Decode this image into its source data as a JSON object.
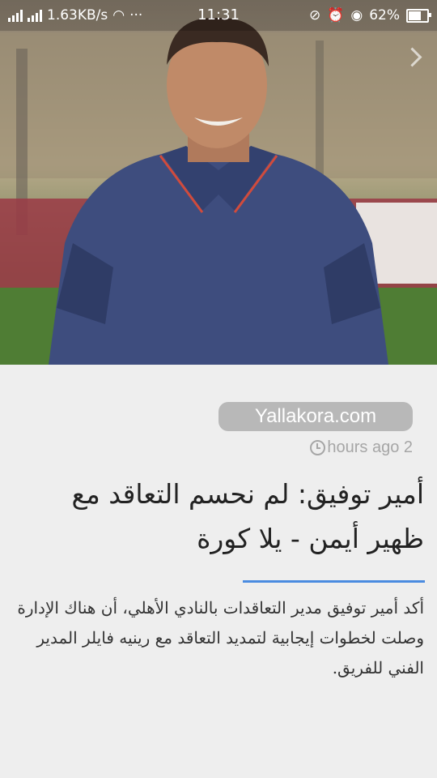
{
  "status_bar": {
    "network_speed": "1.63KB/s",
    "overflow": "···",
    "time": "11:31",
    "battery": "62%"
  },
  "article": {
    "source": "Yallakora.com",
    "timestamp": "hours ago 2",
    "headline": "أمير توفيق: لم نحسم التعاقد مع ظهير أيمن - يلا كورة",
    "summary": "أكد أمير توفيق مدير التعاقدات بالنادي الأهلي، أن هناك الإدارة وصلت لخطوات إيجابية لتمديد التعاقد مع رينيه فايلر المدير الفني للفريق."
  },
  "colors": {
    "accent": "#4a8be0",
    "pill_bg": "#b8b8b8",
    "background": "#eeeeee"
  }
}
